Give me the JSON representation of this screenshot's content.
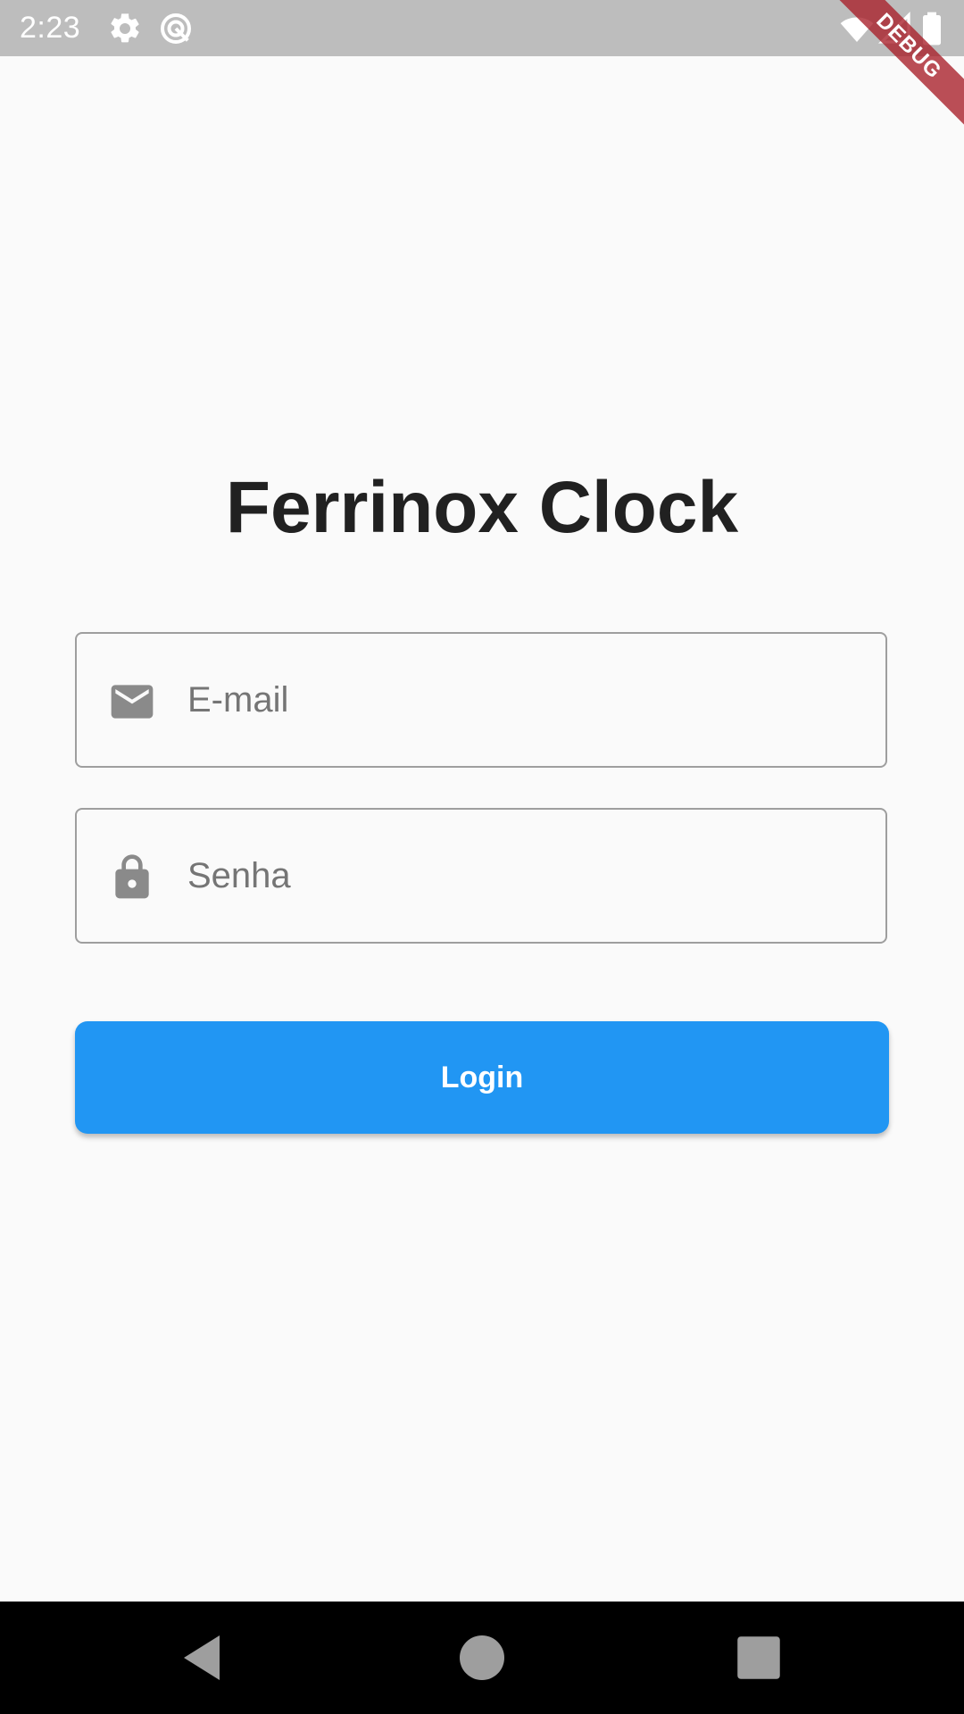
{
  "status_bar": {
    "time": "2:23",
    "icons": [
      "settings-gear-icon",
      "data-saver-icon",
      "wifi-icon",
      "cell-signal-icon",
      "battery-icon"
    ]
  },
  "debug_banner": {
    "label": "DEBUG",
    "color": "#a81e28"
  },
  "login": {
    "title": "Ferrinox Clock",
    "email": {
      "icon": "mail-icon",
      "placeholder": "E-mail",
      "value": ""
    },
    "password": {
      "icon": "lock-icon",
      "placeholder": "Senha",
      "value": ""
    },
    "login_button_label": "Login",
    "accent_color": "#2196f3"
  },
  "navigation_bar": {
    "buttons": [
      "back-icon",
      "home-icon",
      "recents-icon"
    ]
  }
}
